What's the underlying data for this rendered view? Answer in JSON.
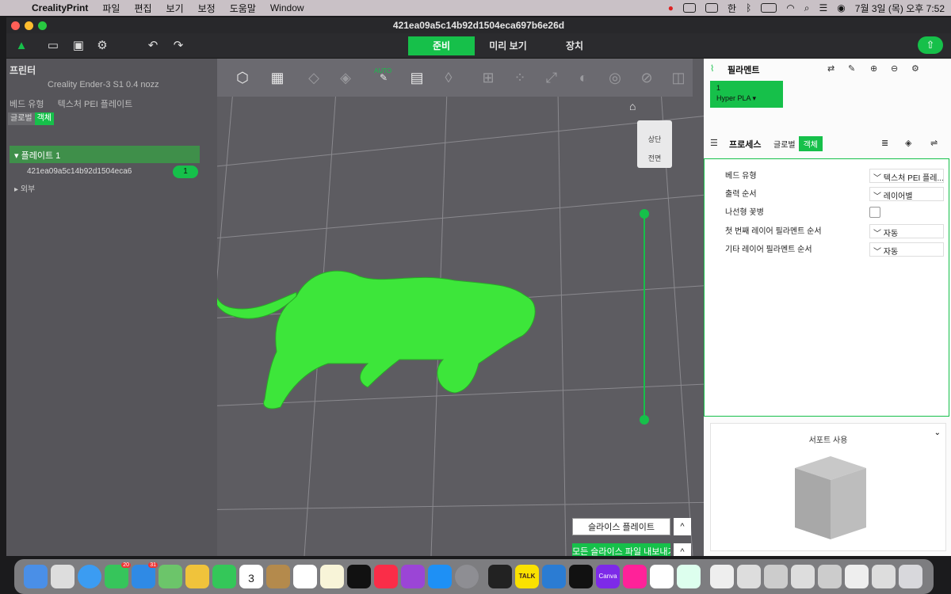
{
  "menubar": {
    "items": [
      "CrealityPrint",
      "파일",
      "편집",
      "보기",
      "보정",
      "도움말",
      "Window"
    ],
    "clock": "7월 3일 (목) 오후  7:52"
  },
  "window": {
    "title": "421ea09a5c14b92d1504eca697b6e26d",
    "tabs": [
      "준비",
      "미리 보기",
      "장치"
    ],
    "active_tab": "준비"
  },
  "left_panel": {
    "printer_title": "프린터",
    "printer_name": "Creality Ender-3 S1 0.4 nozz",
    "bed_label": "베드 유형",
    "bed_value": "텍스처 PEI 플레이트",
    "seg": [
      "글로벌",
      "객체"
    ],
    "plate_label": "플레이트 1",
    "object_name": "421ea09a5c14b92d1504eca6",
    "object_count": "1",
    "outside_label": "외부"
  },
  "viewport": {
    "auto_label": "AUTO",
    "cube_top": "상단",
    "cube_front": "전면",
    "slice_button": "슬라이스 플레이트",
    "export_button": "모든 슬라이스 파일 내보내기",
    "caret": "^"
  },
  "right_panel": {
    "filament_title": "필라멘트",
    "filament_slot": "1",
    "filament_name": "Hyper PLA",
    "process_title": "프로세스",
    "seg": [
      "글로벌",
      "객체"
    ],
    "rows": [
      {
        "label": "베드 유형",
        "value": "텍스처 PEI 플레..."
      },
      {
        "label": "출력 순서",
        "value": "레이어별"
      },
      {
        "label": "나선형 꽃병",
        "value": ""
      },
      {
        "label": "첫 번째 레이어 필라멘트 순서",
        "value": "자동"
      },
      {
        "label": "기타 레이어 필라멘트 순서",
        "value": "자동"
      }
    ],
    "support_title": "서포트 사용"
  },
  "dock": {
    "badge_messages": "20",
    "badge_mail": "31",
    "calendar_day": "3",
    "calendar_month": "7월",
    "talk_label": "TALK",
    "canva_label": "Canva"
  },
  "colors": {
    "accent": "#16c04a",
    "model": "#3de63a"
  }
}
